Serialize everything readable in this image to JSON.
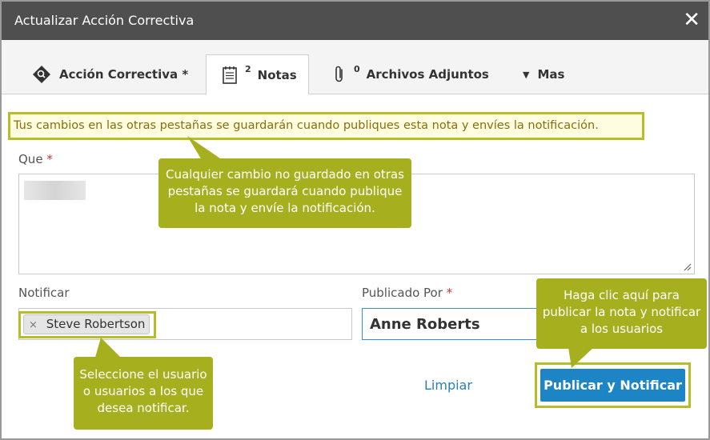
{
  "dialog": {
    "title": "Actualizar Acción Correctiva",
    "close_symbol": "✕"
  },
  "tabs": [
    {
      "label": "Acción Correctiva *",
      "icon": "tag-search-icon"
    },
    {
      "count": "2",
      "label": "Notas",
      "icon": "notepad-icon",
      "active": true
    },
    {
      "count": "0",
      "label": "Archivos Adjuntos",
      "icon": "paperclip-icon"
    },
    {
      "label": "Mas",
      "icon": "caret-down-icon",
      "caret": "▼"
    }
  ],
  "notice": "Tus cambios en las otras pestañas se guardarán cuando publiques esta nota y envíes la notificación.",
  "form": {
    "que_label": "Que",
    "required_mark": "*",
    "notificar_label": "Notificar",
    "recipient_chip": "Steve Robertson",
    "chip_remove": "×",
    "publicado_label": "Publicado Por",
    "publicado_value": "Anne Roberts"
  },
  "actions": {
    "clear_label": "Limpiar",
    "publish_label": "Publicar y Notificar"
  },
  "callouts": {
    "unsaved": "Cualquier cambio no guardado en otras pestañas se guardará cuando publique la nota y envíe la notificación.",
    "publish": "Haga clic aquí para publicar la nota y notificar a los usuarios",
    "select_users": "Seleccione el usuario o usuarios a los que desea notificar."
  },
  "colors": {
    "titlebar": "#4f4f4f",
    "callout": "#a6b01f",
    "highlight_border": "#b5bd2a",
    "primary_button": "#1d84c6",
    "link": "#2a7fb5",
    "notice_text": "#8a6d0b"
  }
}
